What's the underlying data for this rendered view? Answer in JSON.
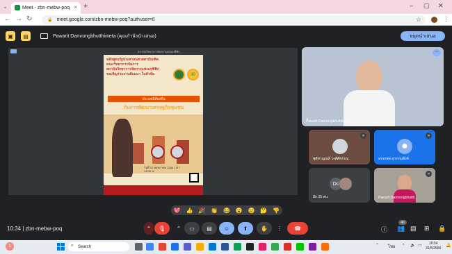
{
  "browser": {
    "tab_title": "Meet - zbn-mebw-poq",
    "url": "meet.google.com/zbn-mebw-poq?authuser=0",
    "new_tab": "+",
    "close_tab": "×"
  },
  "meet": {
    "presenter_label": "Pawarit Damrongbhutthimeta (คุณกำลังนำเสนอ)",
    "stop_presenting": "หยุดนำเสนอ",
    "meeting_code": "10:34  |  zbn-mebw-poq",
    "participant_count": "40",
    "colors": {
      "accent": "#8ab4f8",
      "end_call": "#ea4335",
      "background": "#202124"
    }
  },
  "shared_document": {
    "header_small": "สถาบันวิทยาการจัดการแห่งแปซิฟิก",
    "title_lines": [
      "หลักสูตรรัฐประศาสนศาสตรบัณฑิต",
      "คณะวิทยาการจัดการ",
      "สถาบันวิทยาการจัดการแห่งแปซิฟิก",
      "ขอเชิญร่วมงานสัมมนา ในหัวข้อ"
    ],
    "banner": "ประเพณีท้องถิ่น",
    "subtitle": "กับการพัฒนาเศรษฐกิจชุมชน",
    "seal_badge": "30",
    "info_text": "วันที่ 31 พฤษภาคม 2566 เวลา 13.00 น."
  },
  "tiles": [
    {
      "name": "Pawarit Damrongbhutthimeta",
      "kind": "video"
    },
    {
      "name": "พุติชาญณท์ วงศ์ตัพรรณ",
      "kind": "avatar"
    },
    {
      "name": "อรรถพล สุวรรณสิงห์",
      "kind": "avatar"
    },
    {
      "name": "อีก 35 คน",
      "kind": "group",
      "initials": "Dc"
    },
    {
      "name": "Pawarit Damrongbhutth...",
      "kind": "self"
    }
  ],
  "reactions": [
    "💖",
    "👍",
    "🎉",
    "👏",
    "😂",
    "😮",
    "😢",
    "🤔",
    "👎"
  ],
  "taskbar": {
    "search_placeholder": "Search",
    "tray_lang": "ไทย",
    "time": "10:34",
    "date": "31/5/2566",
    "weather_badge": "1"
  }
}
